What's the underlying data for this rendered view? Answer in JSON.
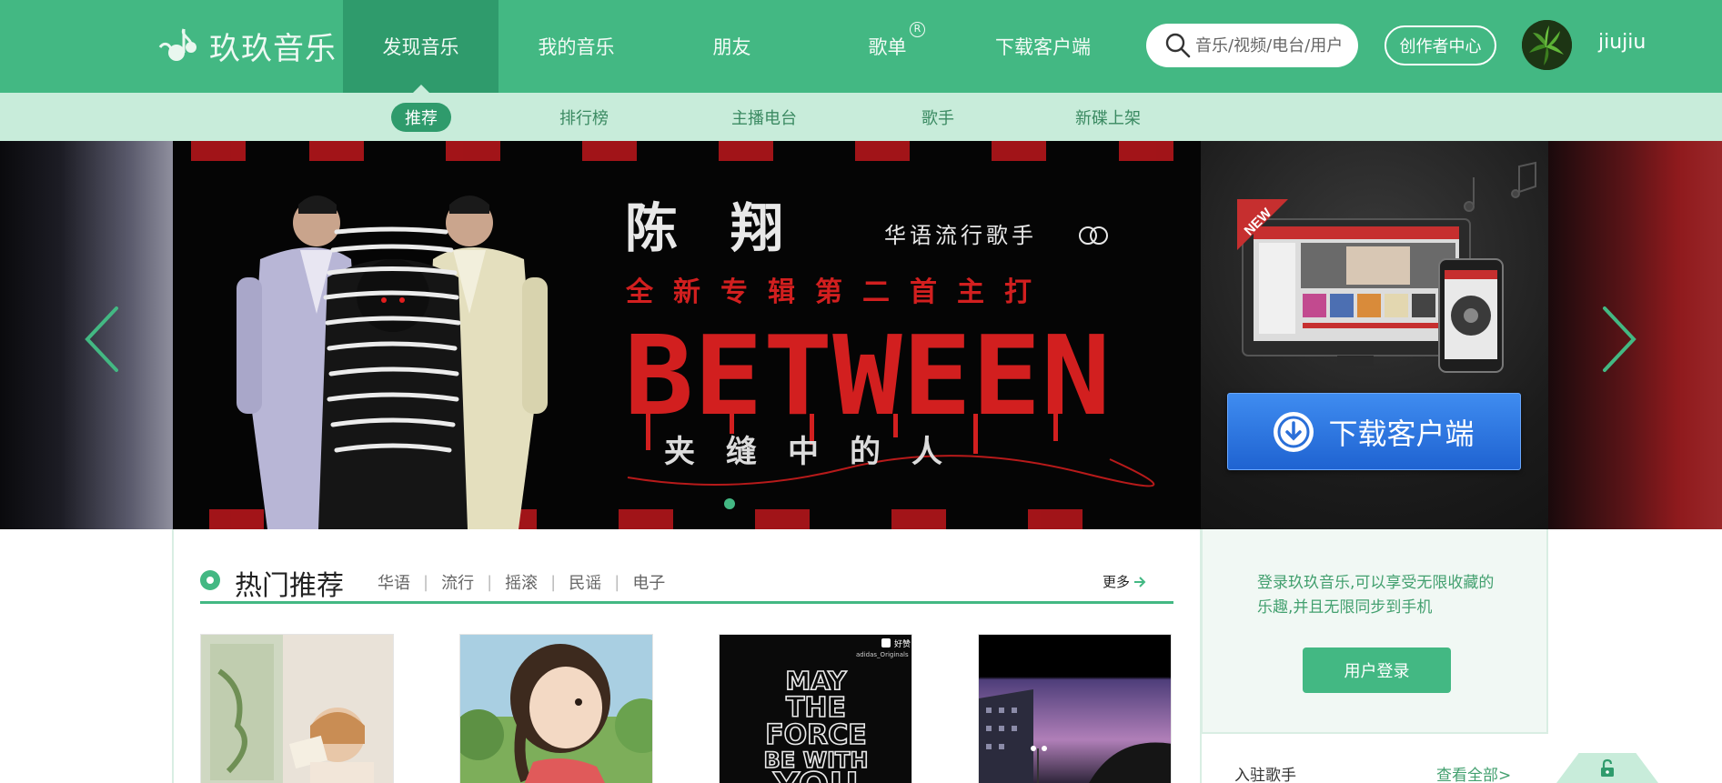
{
  "app": {
    "logo_text": "玖玖音乐"
  },
  "nav": {
    "items": [
      {
        "label": "发现音乐"
      },
      {
        "label": "我的音乐"
      },
      {
        "label": "朋友"
      },
      {
        "label": "歌单",
        "badge": "R"
      },
      {
        "label": "下载客户端"
      }
    ]
  },
  "search": {
    "placeholder": "音乐/视频/电台/用户"
  },
  "header": {
    "creator_label": "创作者中心",
    "username": "jiujiu"
  },
  "subnav": {
    "items": [
      {
        "label": "推荐"
      },
      {
        "label": "排行榜"
      },
      {
        "label": "主播电台"
      },
      {
        "label": "歌手"
      },
      {
        "label": "新碟上架"
      }
    ]
  },
  "banner": {
    "artist": "陈　翔",
    "artist_desc": "华语流行歌手",
    "subtitle": "全新专辑第二首主打",
    "title": "BETWEEN",
    "tagline": "夹　缝　中　的　人"
  },
  "download": {
    "new_badge": "NEW",
    "button_label": "下载客户端"
  },
  "hot": {
    "title": "热门推荐",
    "tags": [
      "华语",
      "流行",
      "摇滚",
      "民谣",
      "电子"
    ],
    "more_label": "更多"
  },
  "covers": {
    "poster_lines": [
      "MAY",
      "THE",
      "FORCE",
      "BE WITH",
      "YOU"
    ],
    "poster_brand": "好赞",
    "poster_handle": "adidas_Originals"
  },
  "login": {
    "text": "登录玖玖音乐,可以享受无限收藏的乐趣,并且无限同步到手机",
    "button_label": "用户登录"
  },
  "singers": {
    "title": "入驻歌手",
    "view_all": "查看全部>"
  },
  "colors": {
    "brand": "#43b883",
    "brand_dark": "#2f9b6c",
    "subnav_bg": "#c8ecda",
    "banner_red": "#d21f1f"
  }
}
